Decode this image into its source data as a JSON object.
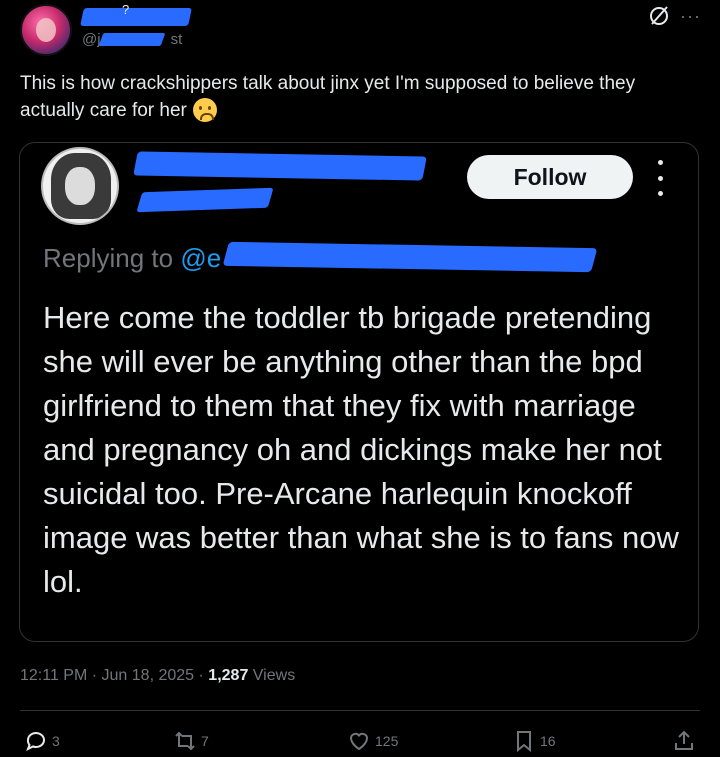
{
  "tweet": {
    "question_mark": "?",
    "handle_prefix": "@j",
    "handle_suffix": "st",
    "text": "This is how crackshippers talk about jinx yet I'm supposed to believe they actually care for her"
  },
  "quote": {
    "follow_label": "Follow",
    "handle_at": "@",
    "replying_to_label": "Replying to",
    "replying_handle_prefix": "@e",
    "text": "Here come the toddler tb brigade pretending she will ever be anything other than the bpd girlfriend to them that they fix with marriage and pregnancy oh and dickings make her not suicidal too. Pre-Arcane harlequin knockoff image was better than what she is to fans now lol."
  },
  "meta": {
    "time": "12:11 PM",
    "separator": "·",
    "date": "Jun 18, 2025",
    "views_count": "1,287",
    "views_label": "Views"
  },
  "actions": {
    "replies": "3",
    "reposts": "7",
    "likes": "125",
    "bookmarks": "16"
  },
  "icons": [
    "grok-icon",
    "more-icon",
    "kebab-icon",
    "reply-icon",
    "repost-icon",
    "like-icon",
    "bookmark-icon",
    "share-icon"
  ],
  "colors": {
    "background": "#000000",
    "text": "#e7e9ea",
    "muted": "#71767b",
    "link": "#1d9bf0",
    "redaction": "#2a6bff",
    "border": "#2f3336"
  }
}
